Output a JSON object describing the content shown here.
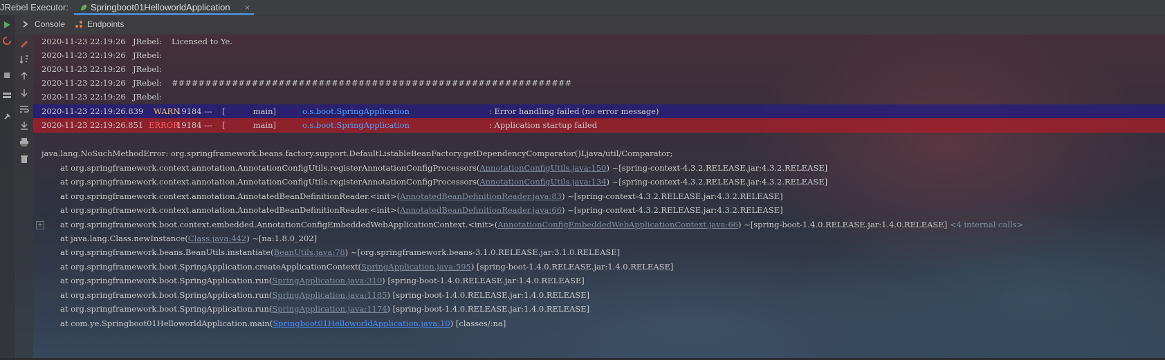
{
  "topbar": {
    "run_label": "JRebel Executor:",
    "tab_title": "Springboot01HelloworldApplication",
    "close_glyph": "×"
  },
  "subtabs": {
    "console": "Console",
    "endpoints": "Endpoints"
  },
  "gutter_icons": [
    "rerun-icon",
    "soft-wrap-icon",
    "scroll-to-end-icon",
    "up-arrow-icon",
    "down-arrow-icon",
    "wrap-icon",
    "download-icon",
    "print-icon",
    "trash-icon"
  ],
  "log": {
    "jrebel_lines": [
      {
        "ts": "2020-11-23 22:19:26",
        "src": "JRebel:",
        "msg": "Licensed to Ye."
      },
      {
        "ts": "2020-11-23 22:19:26",
        "src": "JRebel:",
        "msg": ""
      },
      {
        "ts": "2020-11-23 22:19:26",
        "src": "JRebel:",
        "msg": ""
      },
      {
        "ts": "2020-11-23 22:19:26",
        "src": "JRebel:",
        "msg": "############################################################"
      },
      {
        "ts": "2020-11-23 22:19:26",
        "src": "JRebel:",
        "msg": ""
      }
    ],
    "warn_line": {
      "ts": "2020-11-23 22:19:26.839",
      "level": "WARN",
      "pid": "19184 ---",
      "thread": "[           main]",
      "logger": "o.s.boot.SpringApplication",
      "msg": ": Error handling failed (no error message)"
    },
    "error_line": {
      "ts": "2020-11-23 22:19:26.851",
      "level": "ERROR",
      "pid": "19184 ---",
      "thread": "[           main]",
      "logger": "o.s.boot.SpringApplication",
      "msg": ": Application startup failed"
    },
    "exception": "java.lang.NoSuchMethodError: org.springframework.beans.factory.support.DefaultListableBeanFactory.getDependencyComparator()Ljava/util/Comparator;",
    "stack": [
      {
        "pre": "at org.springframework.context.annotation.AnnotationConfigUtils.registerAnnotationConfigProcessors(",
        "link": "AnnotationConfigUtils.java:150",
        "post": ") ~[spring-context-4.3.2.RELEASE.jar:4.3.2.RELEASE]",
        "extra": ""
      },
      {
        "pre": "at org.springframework.context.annotation.AnnotationConfigUtils.registerAnnotationConfigProcessors(",
        "link": "AnnotationConfigUtils.java:134",
        "post": ") ~[spring-context-4.3.2.RELEASE.jar:4.3.2.RELEASE]",
        "extra": ""
      },
      {
        "pre": "at org.springframework.context.annotation.AnnotatedBeanDefinitionReader.<init>(",
        "link": "AnnotatedBeanDefinitionReader.java:83",
        "post": ") ~[spring-context-4.3.2.RELEASE.jar:4.3.2.RELEASE]",
        "extra": ""
      },
      {
        "pre": "at org.springframework.context.annotation.AnnotatedBeanDefinitionReader.<init>(",
        "link": "AnnotatedBeanDefinitionReader.java:66",
        "post": ") ~[spring-context-4.3.2.RELEASE.jar:4.3.2.RELEASE]",
        "extra": ""
      },
      {
        "pre": "at org.springframework.boot.context.embedded.AnnotationConfigEmbeddedWebApplicationContext.<init>(",
        "link": "AnnotationConfigEmbeddedWebApplicationContext.java:66",
        "post": ") ~[spring-boot-1.4.0.RELEASE.jar:1.4.0.RELEASE]",
        "extra": " <4 internal calls>"
      },
      {
        "pre": "at java.lang.Class.newInstance(",
        "link": "Class.java:442",
        "post": ") ~[na:1.8.0_202]",
        "extra": ""
      },
      {
        "pre": "at org.springframework.beans.BeanUtils.instantiate(",
        "link": "BeanUtils.java:78",
        "post": ") ~[org.springframework.beans-3.1.0.RELEASE.jar:3.1.0.RELEASE]",
        "extra": ""
      },
      {
        "pre": "at org.springframework.boot.SpringApplication.createApplicationContext(",
        "link": "SpringApplication.java:595",
        "post": ") [spring-boot-1.4.0.RELEASE.jar:1.4.0.RELEASE]",
        "extra": ""
      },
      {
        "pre": "at org.springframework.boot.SpringApplication.run(",
        "link": "SpringApplication.java:310",
        "post": ") [spring-boot-1.4.0.RELEASE.jar:1.4.0.RELEASE]",
        "extra": ""
      },
      {
        "pre": "at org.springframework.boot.SpringApplication.run(",
        "link": "SpringApplication.java:1185",
        "post": ") [spring-boot-1.4.0.RELEASE.jar:1.4.0.RELEASE]",
        "extra": ""
      },
      {
        "pre": "at org.springframework.boot.SpringApplication.run(",
        "link": "SpringApplication.java:1174",
        "post": ") [spring-boot-1.4.0.RELEASE.jar:1.4.0.RELEASE]",
        "extra": ""
      },
      {
        "pre": "at com.ye.Springboot01HelloworldApplication.main(",
        "link": "Springboot01HelloworldApplication.java:10",
        "post": ") [classes/:na]",
        "extra": ""
      }
    ]
  },
  "colors": {
    "warn": "#e6c85a",
    "error": "#ff5c5c",
    "logger": "#4fa5ff",
    "link": "#7f8ea0",
    "user_link": "#4a8cff",
    "accent": "#4a88c7"
  }
}
